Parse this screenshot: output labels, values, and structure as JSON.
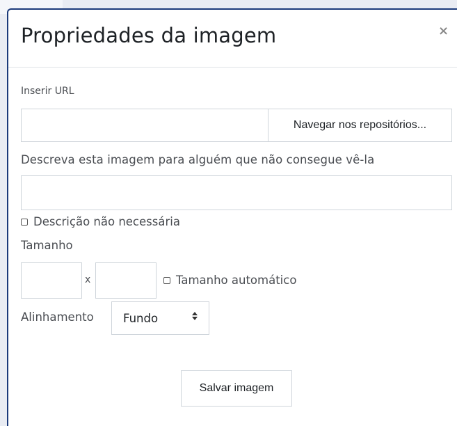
{
  "dialog": {
    "title": "Propriedades da imagem",
    "close_label": "×"
  },
  "url": {
    "label": "Inserir URL",
    "value": "",
    "browse_label": "Navegar nos repositórios..."
  },
  "description": {
    "label": "Descreva esta imagem para alguém que não consegue vê-la",
    "value": "",
    "not_needed_label": "Descrição não necessária",
    "not_needed_checked": false
  },
  "size": {
    "label": "Tamanho",
    "width": "",
    "height": "",
    "separator": "x",
    "auto_label": "Tamanho automático",
    "auto_checked": false
  },
  "alignment": {
    "label": "Alinhamento",
    "selected": "Fundo",
    "arrows": "▲▼"
  },
  "footer": {
    "save_label": "Salvar imagem"
  }
}
